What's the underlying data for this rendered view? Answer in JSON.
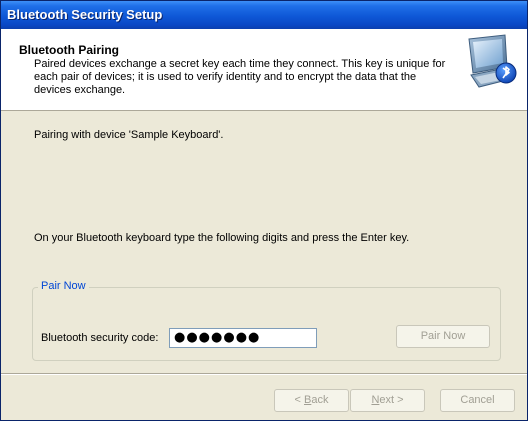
{
  "window": {
    "title": "Bluetooth Security Setup"
  },
  "header": {
    "title": "Bluetooth Pairing",
    "description": "Paired devices exchange a secret key each time they connect. This key is unique for each pair of devices; it is used to verify identity and to encrypt the data that the devices exchange.",
    "icon": "bluetooth-computer-icon"
  },
  "body": {
    "pairing_status": "Pairing with device 'Sample Keyboard'.",
    "instruction": "On your Bluetooth keyboard type the following digits and press the Enter key."
  },
  "pair_group": {
    "label": "Pair Now",
    "code_label": "Bluetooth security code:",
    "code_value": "●●●●●●●",
    "pair_button": "Pair Now"
  },
  "nav": {
    "back_prefix": "< ",
    "back_mnemonic": "B",
    "back_rest": "ack",
    "next_mnemonic": "N",
    "next_rest": "ext >",
    "cancel": "Cancel"
  },
  "colors": {
    "title_bar": "#0a48c6",
    "group_label": "#0046d5",
    "dialog_bg": "#ece9d8"
  }
}
